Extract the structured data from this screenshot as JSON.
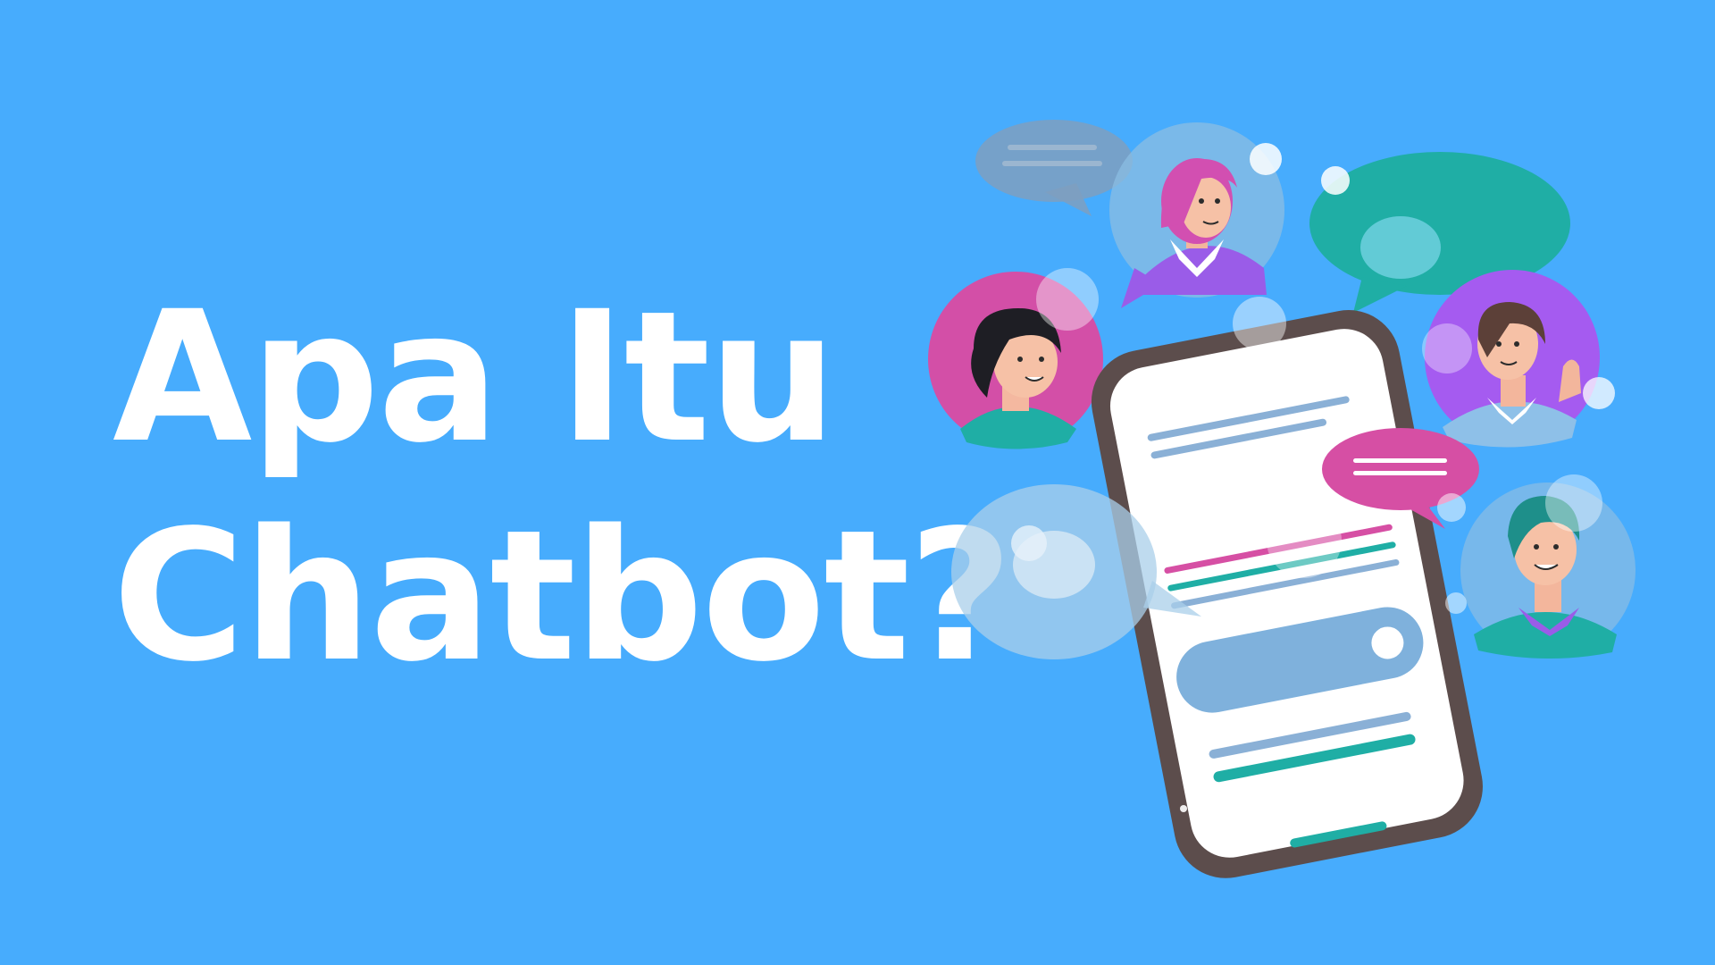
{
  "headline": {
    "line1": "Apa Itu",
    "line2": "Chatbot?"
  },
  "colors": {
    "background": "#47acfd",
    "headline_text": "#ffffff",
    "phone_frame": "#5c4d4c",
    "phone_screen": "#ffffff",
    "teal_accent": "#1faea5",
    "magenta_accent": "#d64fa4",
    "purple_accent": "#a55bf0",
    "bubble_translucent": "#a9cfe9"
  },
  "illustration": {
    "device": "smartphone-with-chat-messages",
    "people": [
      "person-pink-hair",
      "person-dark-hair",
      "person-short-hair-waving",
      "person-teal-hair"
    ],
    "speech_bubbles": [
      "gray-bubble",
      "teal-bubble",
      "pink-bubble",
      "light-blue-bubble"
    ]
  }
}
